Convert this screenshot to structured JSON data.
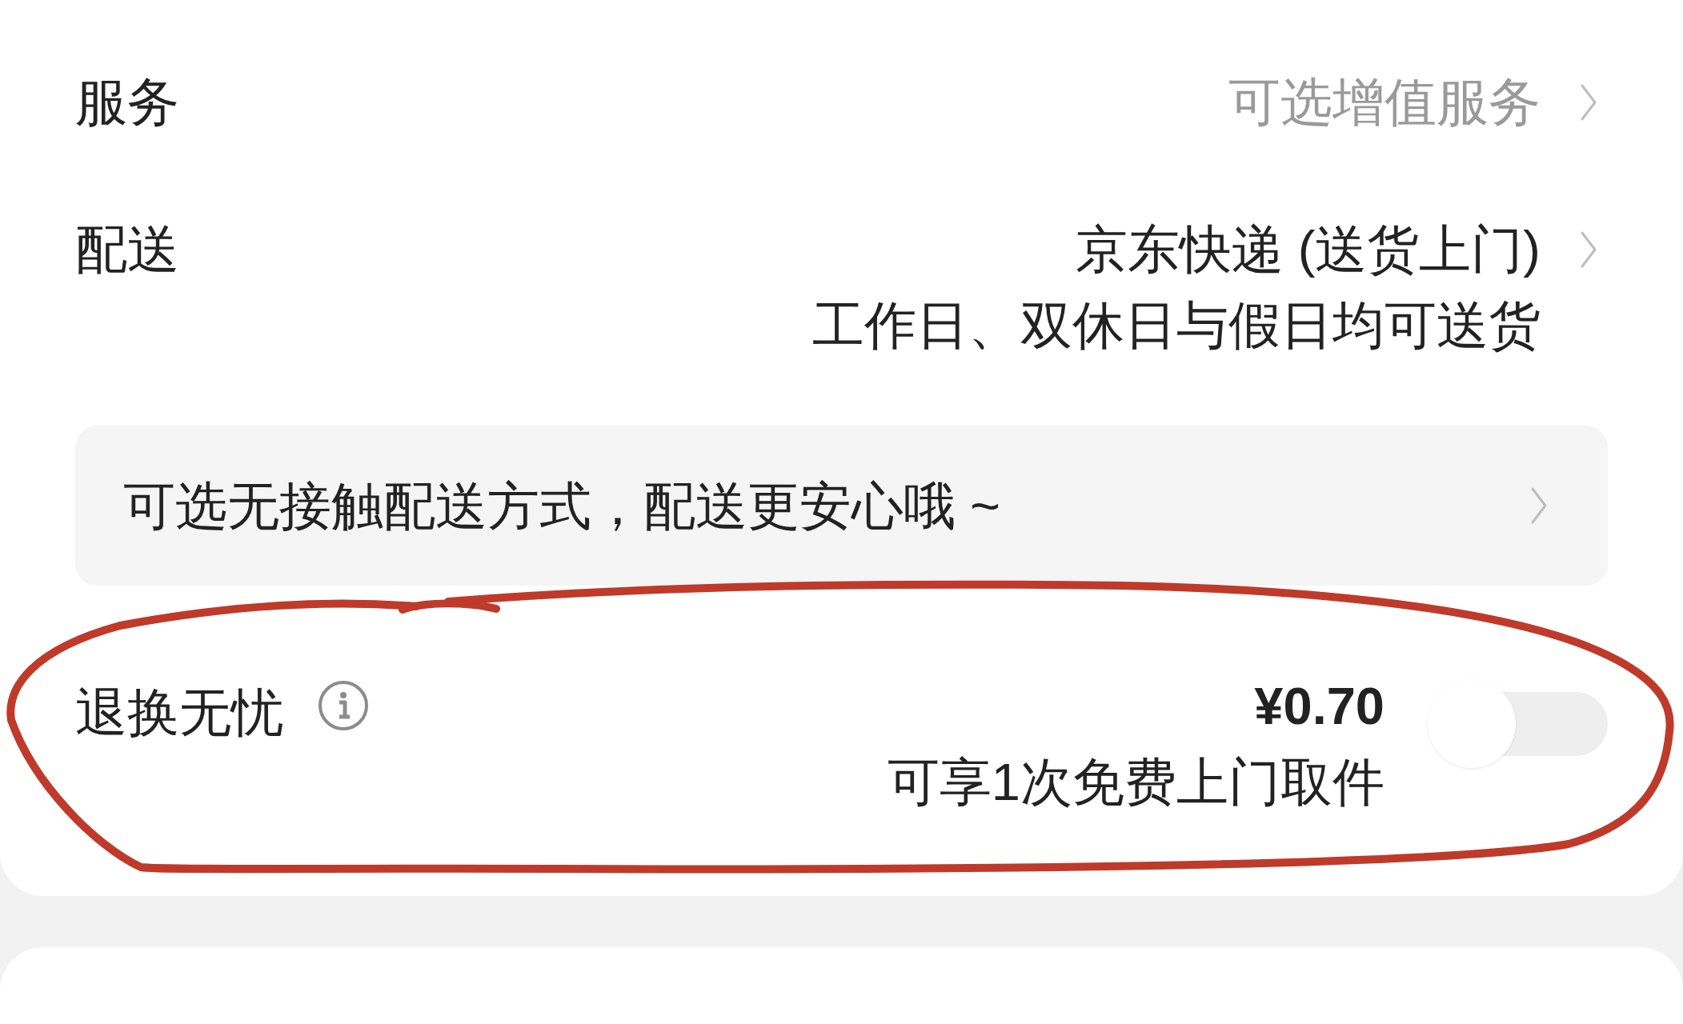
{
  "service": {
    "label": "服务",
    "value": "可选增值服务"
  },
  "delivery": {
    "label": "配送",
    "carrier": "京东快递 (送货上门)",
    "schedule": "工作日、双休日与假日均可送货"
  },
  "contactless_banner": {
    "text": "可选无接触配送方式，配送更安心哦 ~"
  },
  "return_worry_free": {
    "label": "退换无忧",
    "price": "¥0.70",
    "note": "可享1次免费上门取件",
    "on": false
  }
}
